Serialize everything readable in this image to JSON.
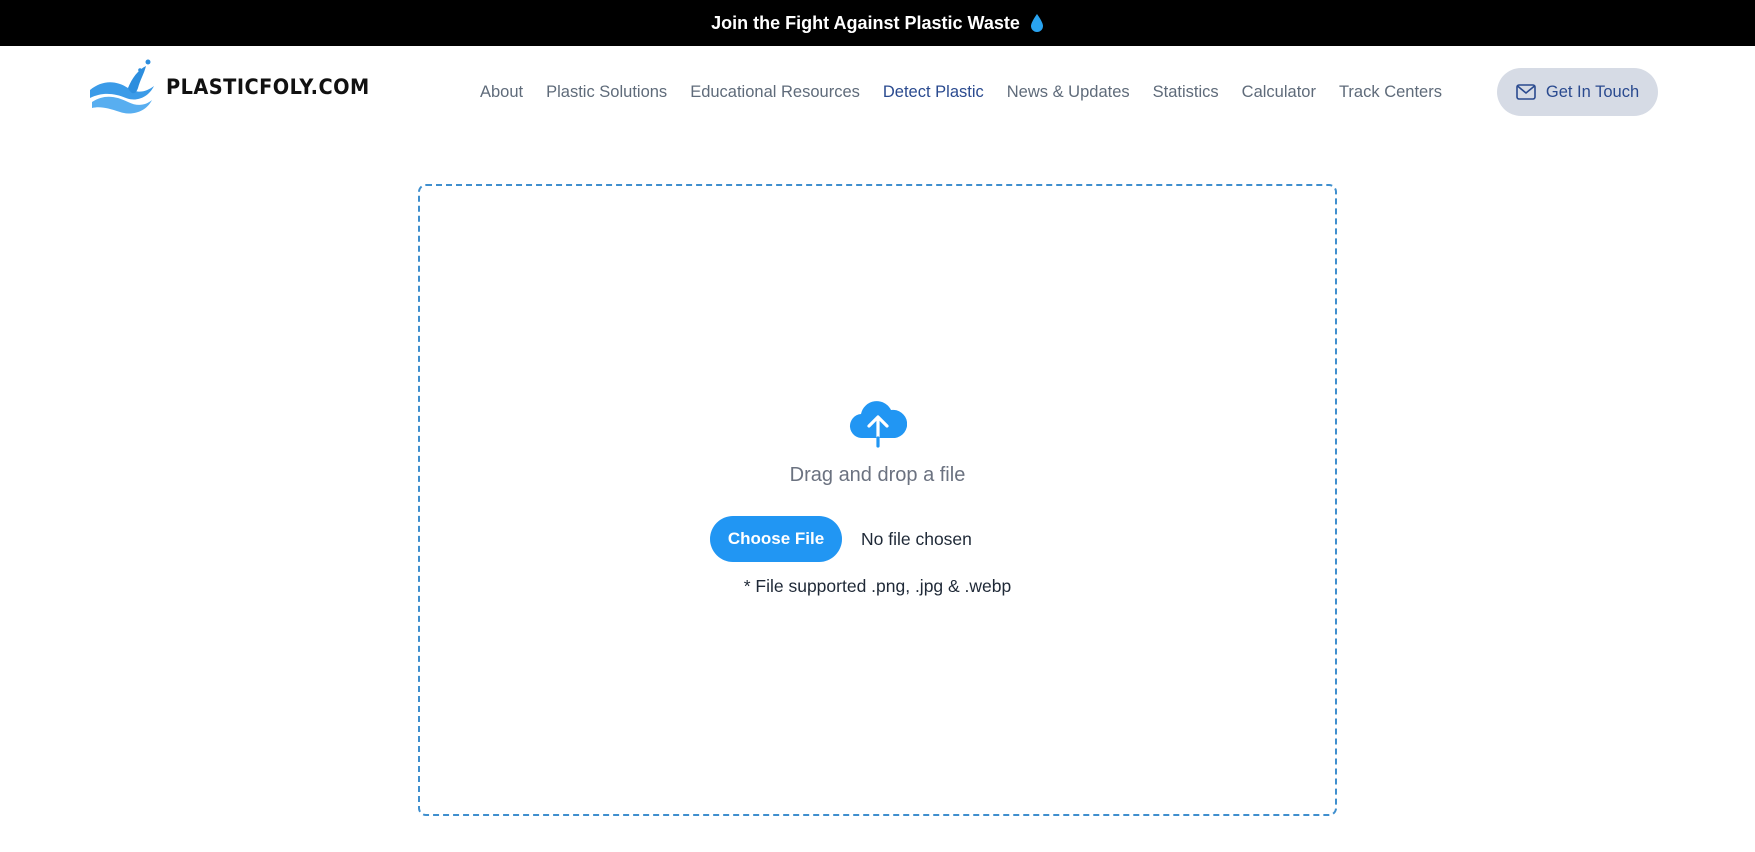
{
  "announcement": {
    "text": "Join the Fight Against Plastic Waste",
    "icon": "water-drop-icon"
  },
  "header": {
    "logo_text": "PLASTICFOLY.COM",
    "nav": [
      {
        "label": "About"
      },
      {
        "label": "Plastic Solutions"
      },
      {
        "label": "Educational Resources"
      },
      {
        "label": "Detect Plastic",
        "active": true
      },
      {
        "label": "News & Updates"
      },
      {
        "label": "Statistics"
      },
      {
        "label": "Calculator"
      },
      {
        "label": "Track Centers"
      }
    ],
    "cta_label": "Get In Touch",
    "cta_icon": "mail-icon"
  },
  "upload": {
    "icon": "cloud-upload-icon",
    "drag_text": "Drag and drop a file",
    "choose_label": "Choose File",
    "file_status": "No file chosen",
    "supported_text": "* File supported .png, .jpg & .webp"
  },
  "colors": {
    "accent": "#2196f3",
    "nav_active": "#2a4a8f",
    "nav_text": "#5f6b7a",
    "cta_bg": "#d6dbe5",
    "dropzone_border": "#3f8fce",
    "announce_bg": "#000000"
  }
}
